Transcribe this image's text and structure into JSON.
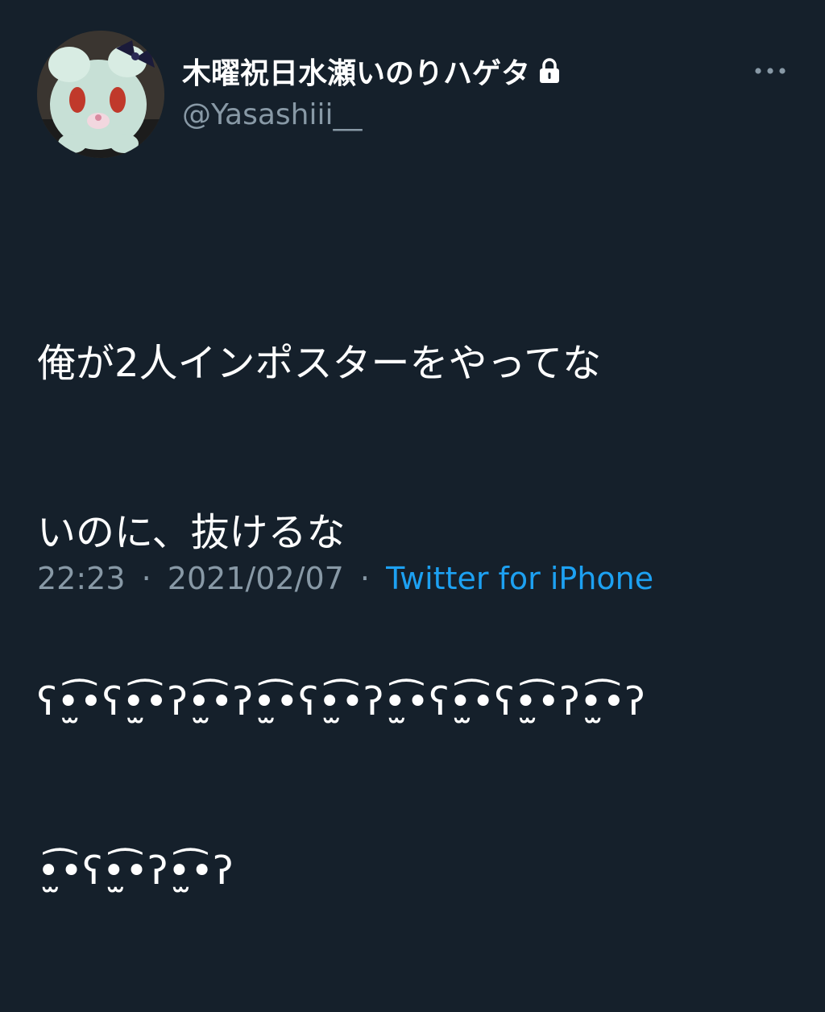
{
  "tweet": {
    "display_name": "木曜祝日水瀬いのりハゲタ",
    "handle": "@Yasashiii__",
    "body_lines": [
      "俺が2人インポスターをやってな",
      "いのに、抜けるな",
      "ʕ•̫͡•ʕ•̫͡•ʔ•̫͡•ʔ•̫͡•ʕ•̫͡•ʔ•̫͡•ʕ•̫͡•ʕ•̫͡•ʔ•̫͡•ʔ",
      "•̫͡•ʕ•̫͡•ʔ•̫͡•ʔ"
    ],
    "time": "22:23",
    "date": "2021/02/07",
    "separator": "·",
    "source": "Twitter for iPhone"
  },
  "icons": {
    "lock": "lock-icon",
    "more": "more-icon"
  },
  "colors": {
    "background": "#15202b",
    "text": "#ffffff",
    "secondary": "#8899a6",
    "link": "#1da1f2"
  }
}
